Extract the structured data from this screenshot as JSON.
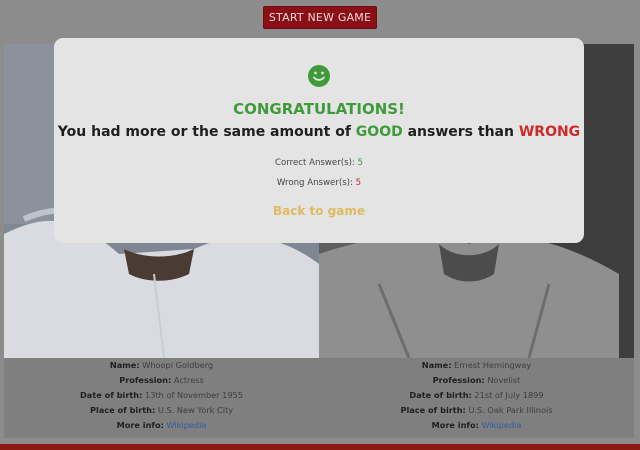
{
  "header": {
    "start_label": "START NEW GAME"
  },
  "left_card": {
    "name_label": "Name:",
    "name": "Whoopi Goldberg",
    "profession_label": "Profession:",
    "profession": "Actress",
    "dob_label": "Date of birth:",
    "dob": "13th of November 1955",
    "pob_label": "Place of birth:",
    "pob": "U.S. New York City",
    "more_label": "More info:",
    "more_link": "Wikipedia"
  },
  "right_card": {
    "name_label": "Name:",
    "name": "Ernest Hemingway",
    "profession_label": "Profession:",
    "profession": "Novelist",
    "dob_label": "Date of birth:",
    "dob": "21st of July 1899",
    "pob_label": "Place of birth:",
    "pob": "U.S. Oak Park Illinois",
    "more_label": "More info:",
    "more_link": "Wikipedia"
  },
  "modal": {
    "icon": "smiley-face-icon",
    "title": "CONGRATULATIONS!",
    "summary_prefix": "You had more or the same amount of",
    "good_word": "GOOD",
    "summary_mid": "answers than",
    "wrong_word": "WRONG",
    "correct_label": "Correct Answer(s):",
    "correct_count": "5",
    "wrong_label": "Wrong Answer(s):",
    "wrong_count": "5",
    "back_label": "Back to game"
  },
  "colors": {
    "accent_green": "#3f9b3a",
    "accent_red": "#cf2a2a",
    "button_red": "#8b0f16",
    "link_gold": "#dfbb5f",
    "link_blue": "#2f5ea8"
  }
}
